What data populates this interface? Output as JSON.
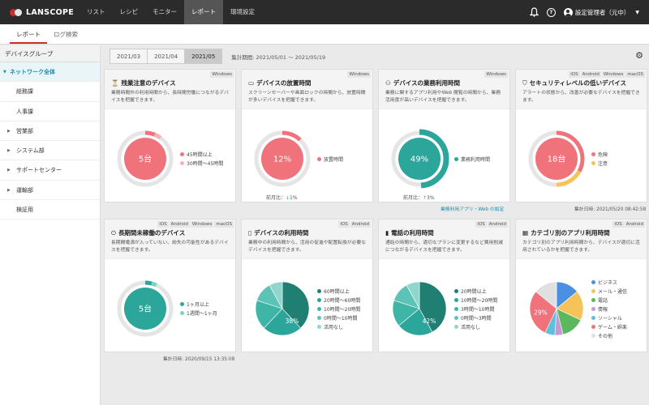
{
  "header": {
    "logo": "LANSCOPE",
    "nav": [
      "リスト",
      "レシピ",
      "モニター",
      "レポート",
      "環境設定"
    ],
    "active_nav": 3,
    "user": "設定管理者（元中）"
  },
  "subnav": {
    "tabs": [
      "レポート",
      "ログ検索"
    ],
    "active": 0
  },
  "sidebar": {
    "title": "デバイスグループ",
    "items": [
      {
        "label": "ネットワーク全体",
        "type": "active"
      },
      {
        "label": "総務課",
        "type": "child"
      },
      {
        "label": "人事課",
        "type": "child"
      },
      {
        "label": "営業部",
        "type": "parent"
      },
      {
        "label": "システム部",
        "type": "parent"
      },
      {
        "label": "サポートセンター",
        "type": "parent"
      },
      {
        "label": "運輸部",
        "type": "parent"
      },
      {
        "label": "検証用",
        "type": "child"
      }
    ]
  },
  "period": {
    "tabs": [
      "2021/03",
      "2021/04",
      "2021/05"
    ],
    "active": 2,
    "label": "集計期間: 2021/05/01 ～ 2021/05/19"
  },
  "colors": {
    "red": "#f0737c",
    "pink": "#f5b1b5",
    "teal": "#2ca59b",
    "teal_light": "#7fd1c6",
    "gray": "#e5e5e5",
    "yellow": "#f6c35b"
  },
  "cards": [
    {
      "title": "残業注意のデバイス",
      "icon": "overtime-icon",
      "badges": [
        "Windows"
      ],
      "desc": "業務時間外の利用時間から、長時間労働につながるデバイスを把握できます。",
      "center": "5台",
      "legend": [
        {
          "label": "45時間以上",
          "color": "#f0737c"
        },
        {
          "label": "30時間〜45時間",
          "color": "#f5b1b5"
        }
      ],
      "segments": [
        6,
        4
      ],
      "compare": null
    },
    {
      "title": "デバイスの放置時間",
      "icon": "monitor-icon",
      "badges": [
        "Windows"
      ],
      "desc": "スクリーンセーバーや画面ロックの時間から、放置時間が多いデバイスを把握できます。",
      "center": "12%",
      "legend": [
        {
          "label": "放置時間",
          "color": "#f0737c"
        }
      ],
      "segments": [
        12
      ],
      "compare": {
        "label": "前月比：",
        "arrow": "↓",
        "value": "1%"
      }
    },
    {
      "title": "デバイスの業務利用時間",
      "icon": "work-icon",
      "badges": [
        "Windows"
      ],
      "desc": "業務に関するアプリ利用やWeb 閲覧の時間から、業務活用度が高いデバイスを把握できます。",
      "center": "49%",
      "legend": [
        {
          "label": "業務利用時間",
          "color": "#2ca59b"
        }
      ],
      "segments": [
        49
      ],
      "compare": {
        "label": "前月比：",
        "arrow": "↑",
        "value": "3%"
      },
      "link": "業務利用アプリ・Web の設定"
    },
    {
      "title": "セキュリティレベルの低いデバイス",
      "icon": "shield-icon",
      "badges": [
        "iOS",
        "Android",
        "Windows",
        "macOS"
      ],
      "desc": "アラートの状態から、改善が必要なデバイスを把握できます。",
      "center": "18台",
      "legend": [
        {
          "label": "危険",
          "color": "#f0737c"
        },
        {
          "label": "注意",
          "color": "#f6c35b"
        }
      ],
      "segments": [
        10,
        5
      ],
      "footer": "集計日時: 2021/05/20 08:42:58"
    },
    {
      "title": "長期間未稼働のデバイス",
      "icon": "power-icon",
      "badges": [
        "iOS",
        "Android",
        "Windows",
        "macOS"
      ],
      "desc": "長期間電源が入っていない、紛失の可能性があるデバイスを把握できます。",
      "center": "5台",
      "legend": [
        {
          "label": "1ヶ月以上",
          "color": "#2ca59b"
        },
        {
          "label": "1週間〜1ヶ月",
          "color": "#7fd1c6"
        }
      ],
      "segments": [
        5,
        2
      ],
      "footer": "集計日時: 2020/09/15 13:35:08"
    },
    {
      "title": "デバイスの利用時間",
      "icon": "device-icon",
      "badges": [
        "iOS",
        "Android"
      ],
      "desc": "業務中の利用時間から、活用の促進や配置転換が必要なデバイスを把握できます。",
      "center": "38%",
      "legend": [
        {
          "label": "60時間以上",
          "color": "#1f7f73"
        },
        {
          "label": "20時間〜60時間",
          "color": "#2ca59b"
        },
        {
          "label": "10時間〜20時間",
          "color": "#3fb5a8"
        },
        {
          "label": "0時間〜10時間",
          "color": "#5cc3b6"
        },
        {
          "label": "活用なし",
          "color": "#8fd6cc"
        }
      ],
      "segments": [
        38,
        24,
        18,
        12,
        8
      ]
    },
    {
      "title": "電話の利用時間",
      "icon": "phone-icon",
      "badges": [
        "iOS",
        "Android"
      ],
      "desc": "通話の時間から、適切なプランに変更するなど費用削減につながるデバイスを把握できます。",
      "center": "42%",
      "legend": [
        {
          "label": "20時間以上",
          "color": "#1f7f73"
        },
        {
          "label": "10時間〜20時間",
          "color": "#2ca59b"
        },
        {
          "label": "3時間〜10時間",
          "color": "#3fb5a8"
        },
        {
          "label": "0時間〜3時間",
          "color": "#5cc3b6"
        },
        {
          "label": "活用なし",
          "color": "#8fd6cc"
        }
      ],
      "segments": [
        42,
        22,
        16,
        12,
        8
      ]
    },
    {
      "title": "カテゴリ別のアプリ利用時間",
      "icon": "category-icon",
      "badges": [
        "iOS",
        "Android"
      ],
      "desc": "カテゴリ別のアプリ利用時間から、デバイスが適切に活用されているかを把握できます。",
      "center": "29%",
      "legend": [
        {
          "label": "ビジネス",
          "color": "#4a90e2"
        },
        {
          "label": "メール・通信",
          "color": "#f6c35b"
        },
        {
          "label": "電話",
          "color": "#5cb85c"
        },
        {
          "label": "情報",
          "color": "#c39bd3"
        },
        {
          "label": "ソーシャル",
          "color": "#5bc0de"
        },
        {
          "label": "ゲーム・娯楽",
          "color": "#f0737c"
        },
        {
          "label": "その他",
          "color": "#e0e0e0"
        }
      ],
      "segments": [
        14,
        18,
        14,
        5,
        6,
        29,
        14
      ]
    }
  ]
}
